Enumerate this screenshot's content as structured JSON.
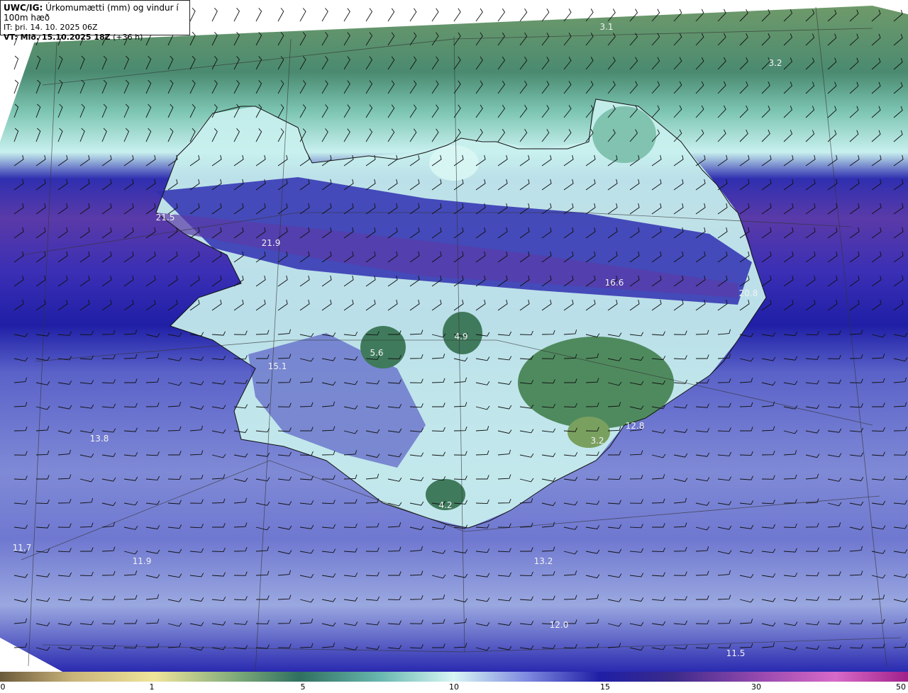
{
  "header": {
    "line1_bold": "UWC/IG:",
    "line1_text": " Úrkomumætti (mm) og vindur í 100m hæð",
    "line2": "IT: þri. 14. 10. 2025 06Z",
    "line3_bold": "VT: Mið. 15.10.2025 18Z",
    "line3_text": " (+36 h)"
  },
  "colors": {
    "water_purple": "#6a3fa8",
    "band_navy": "#1f1fa6",
    "band_indigo": "#3a2fb5",
    "mid_blue": "#5a62c8",
    "pale_blue": "#9aa8e0",
    "cyan": "#c8f0ee",
    "teal": "#4a9e8e",
    "green": "#3f7a5c",
    "olive_green": "#6f9a6a"
  },
  "labels": [
    {
      "text": "3.1"
    },
    {
      "text": "3.2"
    },
    {
      "text": "21.5"
    },
    {
      "text": "21.9"
    },
    {
      "text": "16.6"
    },
    {
      "text": "20.8"
    },
    {
      "text": "4.9"
    },
    {
      "text": "5.6"
    },
    {
      "text": "15.1"
    },
    {
      "text": "13.8"
    },
    {
      "text": "12.8"
    },
    {
      "text": "3.2"
    },
    {
      "text": "4.2"
    },
    {
      "text": "11.7"
    },
    {
      "text": "11.9"
    },
    {
      "text": "13.2"
    },
    {
      "text": "12.0"
    },
    {
      "text": "11.5"
    }
  ],
  "colorbar": {
    "ticks": [
      "0",
      "1",
      "5",
      "10",
      "15",
      "30",
      "50"
    ]
  }
}
